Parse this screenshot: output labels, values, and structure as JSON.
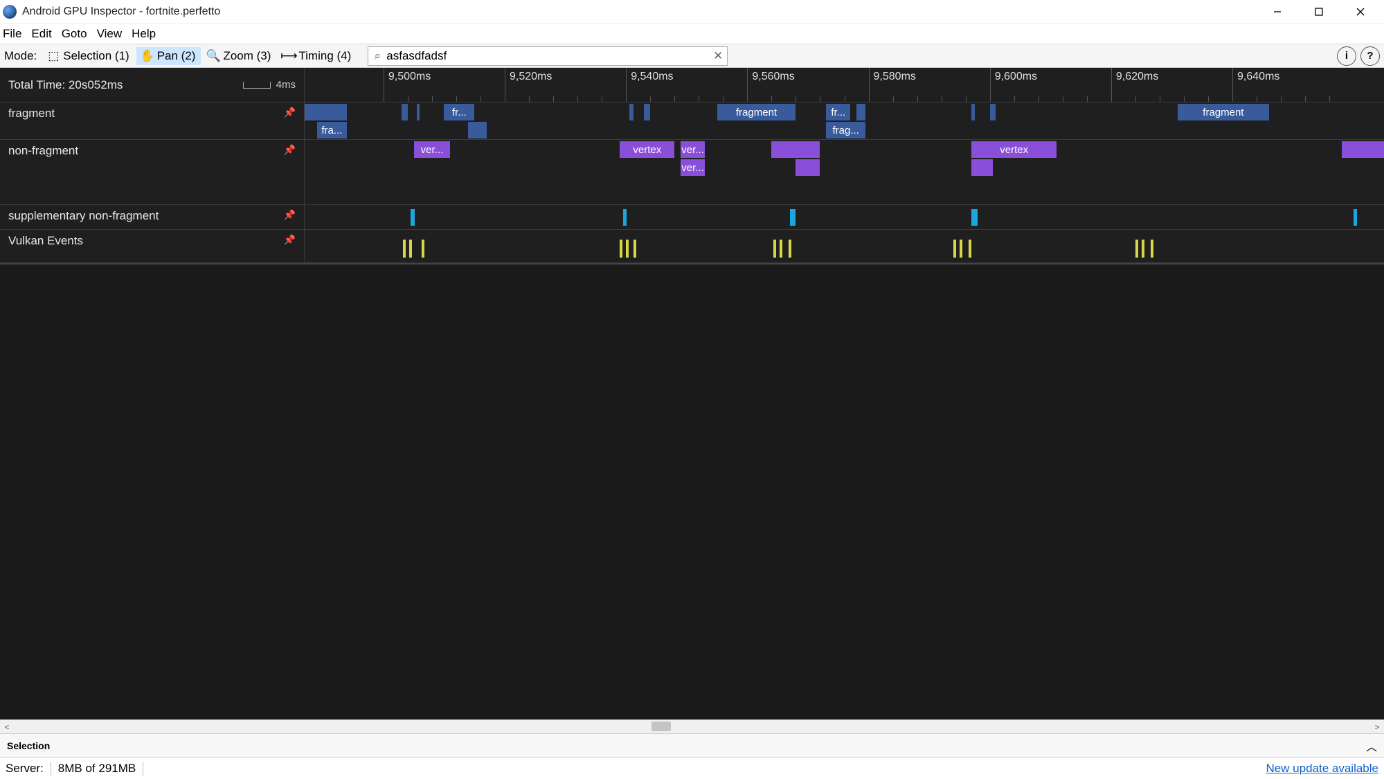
{
  "window": {
    "title": "Android GPU Inspector - fortnite.perfetto"
  },
  "menubar": [
    "File",
    "Edit",
    "Goto",
    "View",
    "Help"
  ],
  "toolbar": {
    "mode_label": "Mode:",
    "modes": [
      {
        "label": "Selection (1)",
        "icon": "selection-icon",
        "active": false
      },
      {
        "label": "Pan (2)",
        "icon": "hand-icon",
        "active": true
      },
      {
        "label": "Zoom (3)",
        "icon": "magnifier-icon",
        "active": false
      },
      {
        "label": "Timing (4)",
        "icon": "timing-icon",
        "active": false
      }
    ],
    "search_value": "asfasdfadsf"
  },
  "timeline": {
    "total_time_label": "Total Time: 20s052ms",
    "scale_label": "4ms",
    "view_start_ms": 9487,
    "view_end_ms": 9665,
    "major_ticks": [
      "9,500ms",
      "9,520ms",
      "9,540ms",
      "9,560ms",
      "9,580ms",
      "9,600ms",
      "9,620ms",
      "9,640ms"
    ],
    "major_tick_values": [
      9500,
      9520,
      9540,
      9560,
      9580,
      9600,
      9620,
      9640
    ],
    "tracks": [
      {
        "name": "fragment",
        "kind": "frag",
        "rows": 2,
        "events": [
          {
            "row": 0,
            "start": 9487,
            "end": 9494,
            "label": ""
          },
          {
            "row": 1,
            "start": 9489,
            "end": 9494,
            "label": "fra..."
          },
          {
            "row": 0,
            "start": 9503,
            "end": 9504,
            "label": ""
          },
          {
            "row": 0,
            "start": 9505.5,
            "end": 9506,
            "label": ""
          },
          {
            "row": 0,
            "start": 9510,
            "end": 9515,
            "label": "fr..."
          },
          {
            "row": 1,
            "start": 9514,
            "end": 9517,
            "label": ""
          },
          {
            "row": 0,
            "start": 9540.5,
            "end": 9541.2,
            "label": ""
          },
          {
            "row": 0,
            "start": 9543,
            "end": 9544,
            "label": ""
          },
          {
            "row": 0,
            "start": 9555,
            "end": 9568,
            "label": "fragment"
          },
          {
            "row": 0,
            "start": 9573,
            "end": 9577,
            "label": "fr..."
          },
          {
            "row": 1,
            "start": 9573,
            "end": 9579.5,
            "label": "frag..."
          },
          {
            "row": 0,
            "start": 9578,
            "end": 9579.5,
            "label": ""
          },
          {
            "row": 0,
            "start": 9597,
            "end": 9597.5,
            "label": ""
          },
          {
            "row": 0,
            "start": 9600,
            "end": 9601,
            "label": ""
          },
          {
            "row": 0,
            "start": 9631,
            "end": 9646,
            "label": "fragment"
          }
        ]
      },
      {
        "name": "non-fragment",
        "kind": "vert",
        "rows": 2,
        "events": [
          {
            "row": 0,
            "start": 9505,
            "end": 9511,
            "label": "ver..."
          },
          {
            "row": 0,
            "start": 9539,
            "end": 9548,
            "label": "vertex",
            "supp_prefix": true
          },
          {
            "row": 0,
            "start": 9549,
            "end": 9553,
            "label": "ver..."
          },
          {
            "row": 1,
            "start": 9549,
            "end": 9553,
            "label": "ver..."
          },
          {
            "row": 0,
            "start": 9564,
            "end": 9572,
            "label": ""
          },
          {
            "row": 1,
            "start": 9568,
            "end": 9572,
            "label": ""
          },
          {
            "row": 0,
            "start": 9597,
            "end": 9611,
            "label": "vertex",
            "supp_prefix": true
          },
          {
            "row": 1,
            "start": 9597,
            "end": 9600.5,
            "label": ""
          },
          {
            "row": 0,
            "start": 9658,
            "end": 9665,
            "label": ""
          }
        ]
      },
      {
        "name": "supplementary non-fragment",
        "kind": "supp",
        "rows": 1,
        "events": [
          {
            "row": 0,
            "start": 9504.5,
            "end": 9505.1,
            "label": ""
          },
          {
            "row": 0,
            "start": 9539.5,
            "end": 9540.1,
            "label": ""
          },
          {
            "row": 0,
            "start": 9567,
            "end": 9568,
            "label": ""
          },
          {
            "row": 0,
            "start": 9597,
            "end": 9598,
            "label": ""
          },
          {
            "row": 0,
            "start": 9660,
            "end": 9660.6,
            "label": ""
          }
        ]
      },
      {
        "name": "Vulkan Events",
        "kind": "vulk",
        "rows": 1,
        "events": [
          {
            "row": 0,
            "start": 9503.2,
            "end": 9503.6
          },
          {
            "row": 0,
            "start": 9504.2,
            "end": 9504.6
          },
          {
            "row": 0,
            "start": 9506.3,
            "end": 9506.7
          },
          {
            "row": 0,
            "start": 9539.0,
            "end": 9539.4
          },
          {
            "row": 0,
            "start": 9540.0,
            "end": 9540.4
          },
          {
            "row": 0,
            "start": 9541.2,
            "end": 9541.6
          },
          {
            "row": 0,
            "start": 9564.3,
            "end": 9564.7
          },
          {
            "row": 0,
            "start": 9565.3,
            "end": 9565.7
          },
          {
            "row": 0,
            "start": 9566.8,
            "end": 9567.2
          },
          {
            "row": 0,
            "start": 9594.0,
            "end": 9594.4
          },
          {
            "row": 0,
            "start": 9595.0,
            "end": 9595.4
          },
          {
            "row": 0,
            "start": 9596.5,
            "end": 9596.9
          },
          {
            "row": 0,
            "start": 9624.0,
            "end": 9624.4
          },
          {
            "row": 0,
            "start": 9625.0,
            "end": 9625.4
          },
          {
            "row": 0,
            "start": 9626.5,
            "end": 9626.9
          }
        ]
      }
    ]
  },
  "selection_panel": {
    "title": "Selection"
  },
  "statusbar": {
    "server_label": "Server:",
    "memory": "8MB of 291MB",
    "update_link": "New update available"
  },
  "mode_icons": {
    "selection-icon": "⬚",
    "hand-icon": "✋",
    "magnifier-icon": "🔍",
    "timing-icon": "⟼"
  }
}
